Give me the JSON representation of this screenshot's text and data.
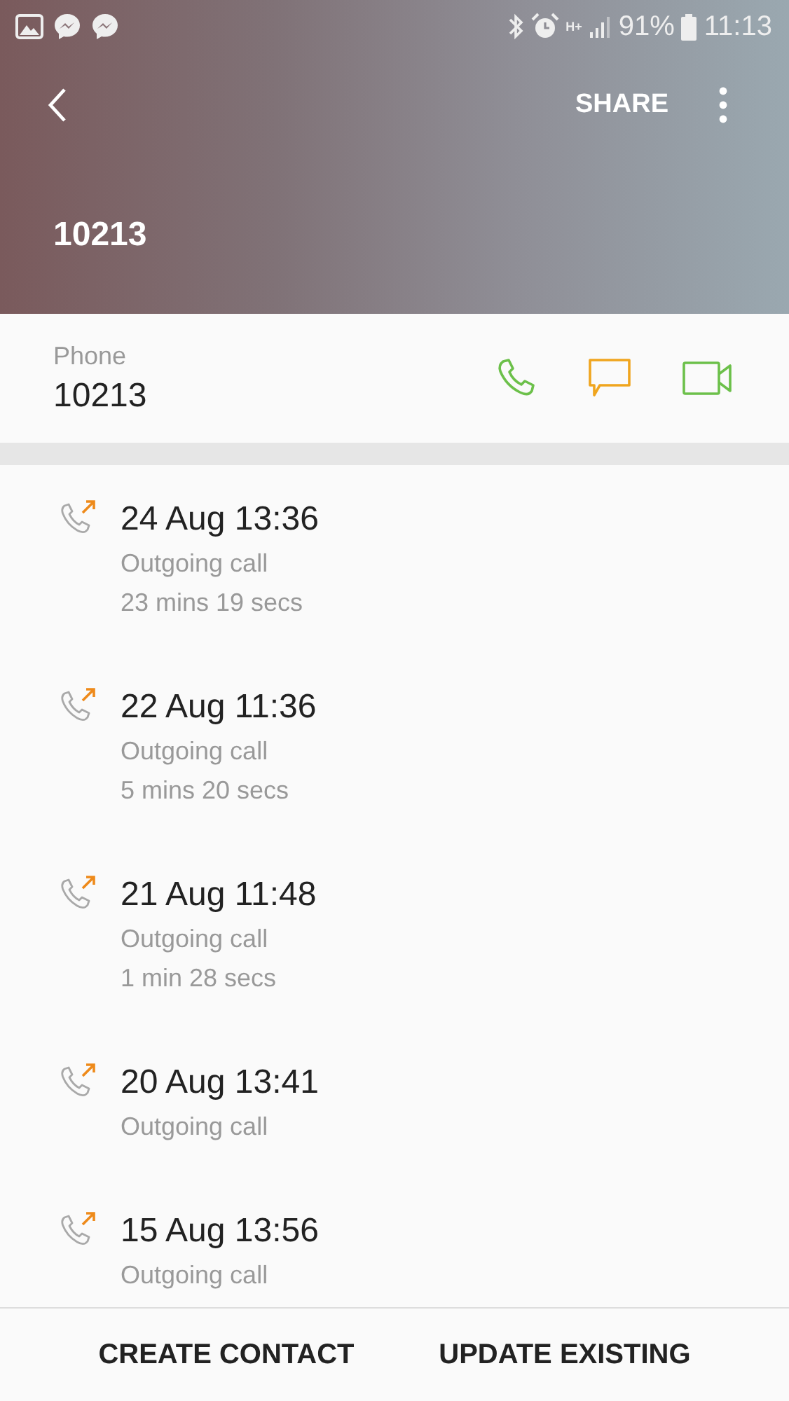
{
  "status_bar": {
    "network": "H+",
    "battery": "91%",
    "time": "11:13"
  },
  "header": {
    "share": "SHARE",
    "title": "10213"
  },
  "phone": {
    "label": "Phone",
    "number": "10213"
  },
  "calls": [
    {
      "date": "24 Aug 13:36",
      "type": "Outgoing call",
      "duration": "23 mins 19 secs"
    },
    {
      "date": "22 Aug 11:36",
      "type": "Outgoing call",
      "duration": "5 mins 20 secs"
    },
    {
      "date": "21 Aug 11:48",
      "type": "Outgoing call",
      "duration": "1 min 28 secs"
    },
    {
      "date": "20 Aug 13:41",
      "type": "Outgoing call"
    },
    {
      "date": "15 Aug 13:56",
      "type": "Outgoing call"
    }
  ],
  "buttons": [
    "CREATE CONTACT",
    "UPDATE EXISTING"
  ]
}
